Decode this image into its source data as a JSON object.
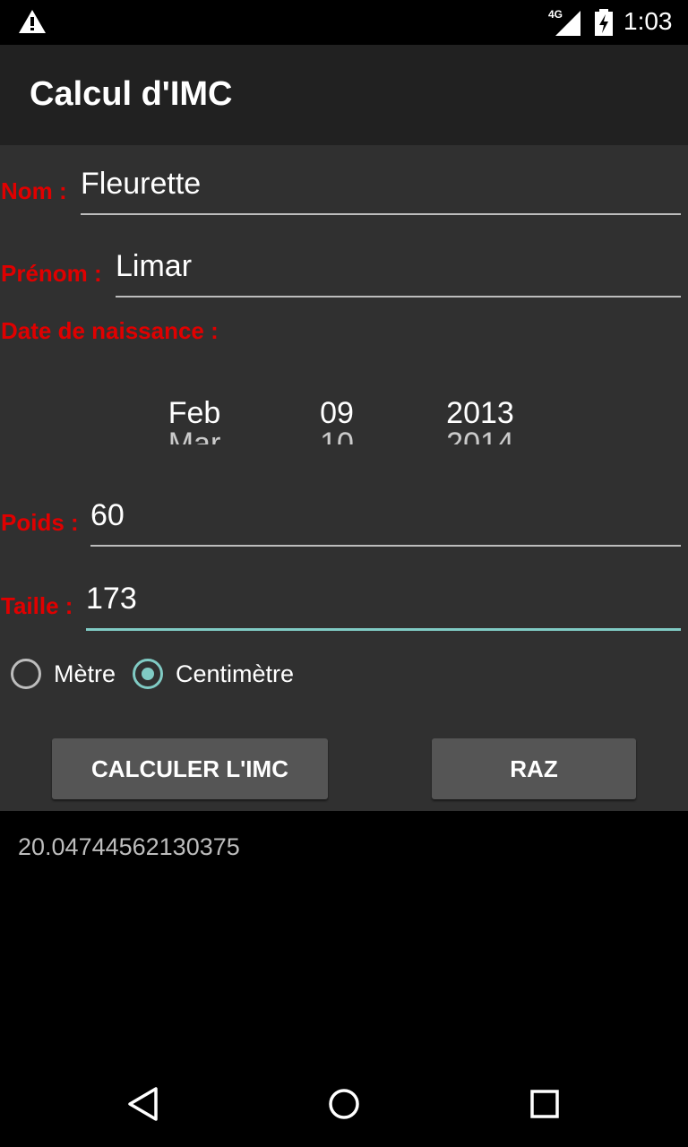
{
  "status_bar": {
    "network_type": "4G",
    "time": "1:03",
    "icons": [
      "warning-icon",
      "signal-icon",
      "battery-charging-icon"
    ]
  },
  "app_bar": {
    "title": "Calcul d'IMC"
  },
  "form": {
    "nom": {
      "label": "Nom :",
      "value": "Fleurette"
    },
    "prenom": {
      "label": "Prénom :",
      "value": "Limar"
    },
    "date_label": "Date de naissance :",
    "date_picker": {
      "month": "Feb",
      "month_next": "Mar",
      "day": "09",
      "day_next": "10",
      "year": "2013",
      "year_next": "2014"
    },
    "poids": {
      "label": "Poids :",
      "value": "60"
    },
    "taille": {
      "label": "Taille :",
      "value": "173"
    },
    "unit_options": [
      {
        "label": "Mètre",
        "checked": false
      },
      {
        "label": "Centimètre",
        "checked": true
      }
    ]
  },
  "buttons": {
    "calculate": "CALCULER L'IMC",
    "reset": "RAZ"
  },
  "result": "20.04744562130375",
  "colors": {
    "label_red": "#e00000",
    "accent": "#80cbc4",
    "content_bg": "#303030",
    "appbar_bg": "#212121"
  },
  "navigation": [
    "back-icon",
    "home-icon",
    "recents-icon"
  ]
}
